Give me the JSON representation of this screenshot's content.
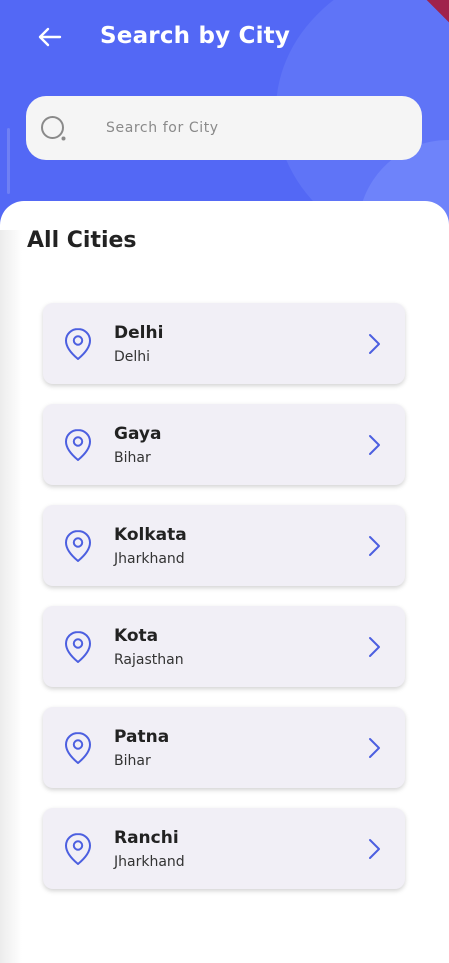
{
  "header": {
    "title": "Search by City",
    "back_icon": "arrow-left-icon",
    "color": "#5368f5"
  },
  "search": {
    "placeholder": "Search for City",
    "value": "",
    "icon": "search-icon"
  },
  "section": {
    "title": "All Cities"
  },
  "cities": [
    {
      "name": "Delhi",
      "state": "Delhi"
    },
    {
      "name": "Gaya",
      "state": "Bihar"
    },
    {
      "name": "Kolkata",
      "state": "Jharkhand"
    },
    {
      "name": "Kota",
      "state": "Rajasthan"
    },
    {
      "name": "Patna",
      "state": "Bihar"
    },
    {
      "name": "Ranchi",
      "state": "Jharkhand"
    }
  ],
  "colors": {
    "accent": "#5368f5",
    "card_bg": "#f1eff6",
    "icon": "#4c5fe0"
  }
}
